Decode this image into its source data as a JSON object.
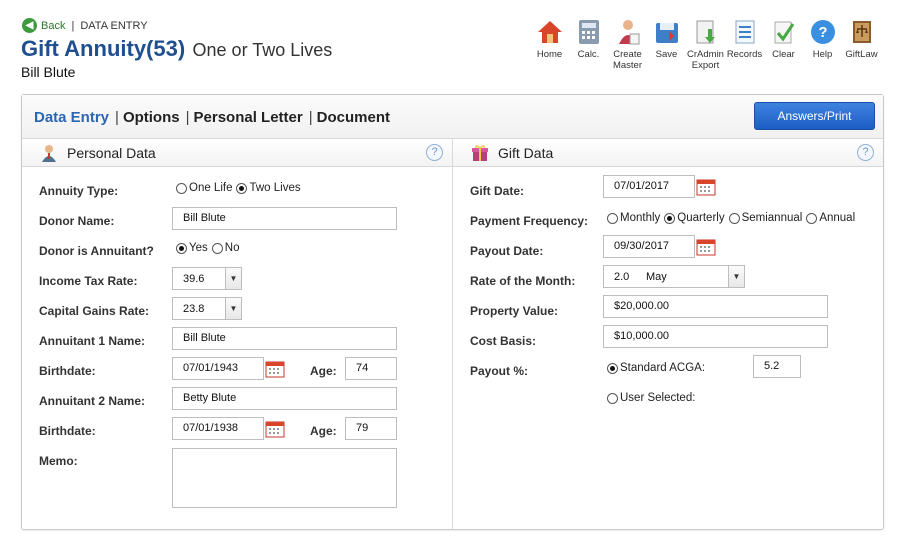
{
  "header": {
    "back_label": "Back",
    "breadcrumb": "DATA ENTRY",
    "title": "Gift Annuity(53)",
    "subtitle": "One or Two Lives",
    "client": "Bill Blute"
  },
  "toolbar": [
    {
      "label": "Home",
      "icon": "home-icon"
    },
    {
      "label": "Calc.",
      "icon": "calculator-icon"
    },
    {
      "label": "Create Master",
      "icon": "create-master-icon"
    },
    {
      "label": "Save",
      "icon": "save-icon"
    },
    {
      "label": "CrAdmin Export",
      "icon": "export-icon"
    },
    {
      "label": "Records",
      "icon": "records-icon"
    },
    {
      "label": "Clear",
      "icon": "clear-icon"
    },
    {
      "label": "Help",
      "icon": "help-icon"
    },
    {
      "label": "GiftLaw",
      "icon": "giftlaw-icon"
    }
  ],
  "tabs": [
    "Data Entry",
    "Options",
    "Personal Letter",
    "Document"
  ],
  "answers_button": "Answers/Print",
  "personal": {
    "title": "Personal Data",
    "annuity_type_label": "Annuity Type:",
    "annuity_options": [
      "One Life",
      "Two Lives"
    ],
    "annuity_selected": "Two Lives",
    "donor_name_label": "Donor Name:",
    "donor_name": "Bill Blute",
    "donor_annuitant_label": "Donor is Annuitant?",
    "donor_annuitant_options": [
      "Yes",
      "No"
    ],
    "donor_annuitant_selected": "Yes",
    "income_tax_label": "Income Tax Rate:",
    "income_tax": "39.6",
    "capital_gains_label": "Capital Gains Rate:",
    "capital_gains": "23.8",
    "annuitant1_label": "Annuitant 1 Name:",
    "annuitant1": "Bill Blute",
    "birthdate_label": "Birthdate:",
    "birthdate1": "07/01/1943",
    "age_label": "Age:",
    "age1": "74",
    "annuitant2_label": "Annuitant 2 Name:",
    "annuitant2": "Betty Blute",
    "birthdate2": "07/01/1938",
    "age2": "79",
    "memo_label": "Memo:"
  },
  "gift": {
    "title": "Gift Data",
    "gift_date_label": "Gift Date:",
    "gift_date": "07/01/2017",
    "frequency_label": "Payment Frequency:",
    "frequency_options": [
      "Monthly",
      "Quarterly",
      "Semiannual",
      "Annual"
    ],
    "frequency_selected": "Quarterly",
    "payout_date_label": "Payout Date:",
    "payout_date": "09/30/2017",
    "rate_label": "Rate of the Month:",
    "rate_value": "2.0",
    "rate_month": "May",
    "property_label": "Property Value:",
    "property_value": "$20,000.00",
    "cost_label": "Cost Basis:",
    "cost_value": "$10,000.00",
    "payout_pct_label": "Payout %:",
    "standard_label": "Standard ACGA:",
    "standard_value": "5.2",
    "user_selected_label": "User Selected:"
  },
  "colors": {
    "accent": "#2b66b1",
    "title": "#1f4f8f",
    "button": "#1c5cc4"
  }
}
